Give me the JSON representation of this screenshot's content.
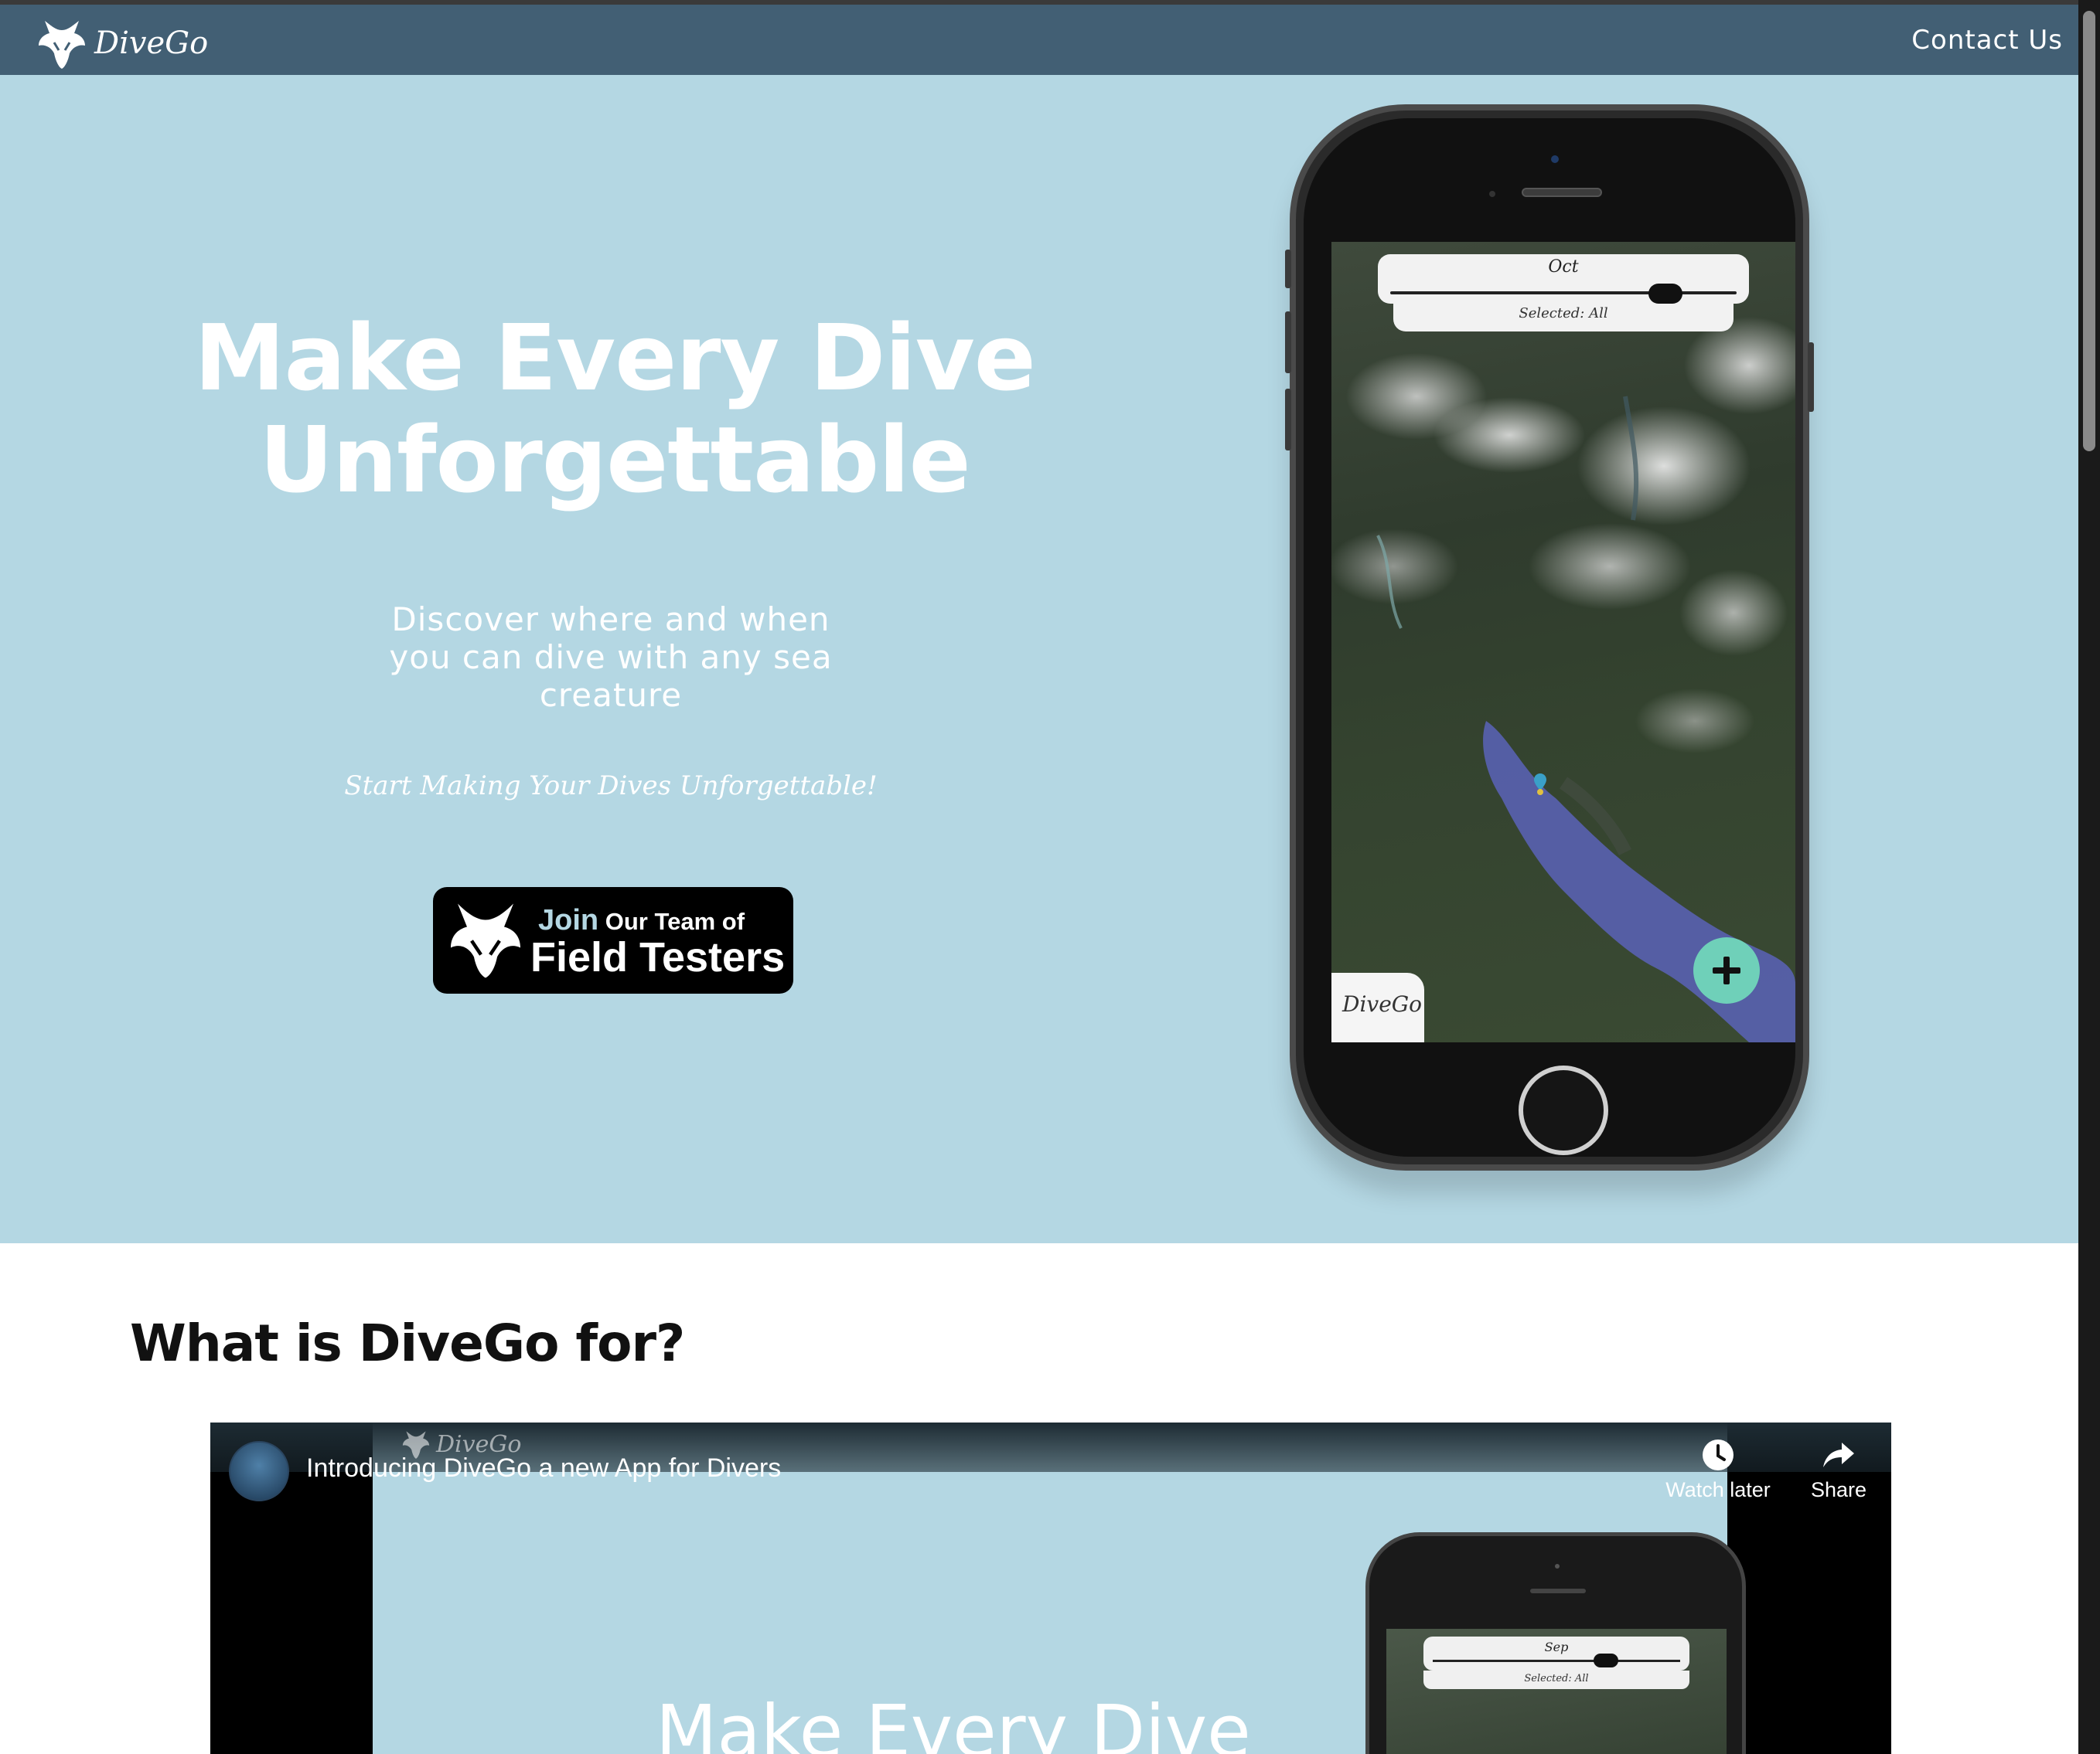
{
  "brand": {
    "name": "DiveGo",
    "logo_icon": "manta-ray-icon"
  },
  "nav": {
    "contact_label": "Contact Us"
  },
  "hero": {
    "title_line1": "Make Every Dive",
    "title_line2": "Unforgettable",
    "subtitle": "Discover where and when you can dive with any sea creature",
    "tagline": "Start Making Your Dives Unforgettable!",
    "cta": {
      "join": "Join",
      "line1_rest": " Our Team of",
      "line2": "Field Testers"
    }
  },
  "phone_app": {
    "month": "Oct",
    "selected_label": "Selected: All",
    "logo_text": "DiveGo",
    "add_icon": "plus-icon"
  },
  "section": {
    "title": "What is DiveGo for?"
  },
  "video": {
    "title": "Introducing DiveGo a new App for Divers",
    "watermark": "DiveGo",
    "watch_later_label": "Watch later",
    "share_label": "Share",
    "headline": "Make Every Dive",
    "month": "Sep",
    "selected_label": "Selected: All"
  },
  "colors": {
    "navbar": "#425f74",
    "hero_bg": "#b4d7e3",
    "cta_bg": "#000000",
    "accent_add": "#6fd0b9"
  }
}
